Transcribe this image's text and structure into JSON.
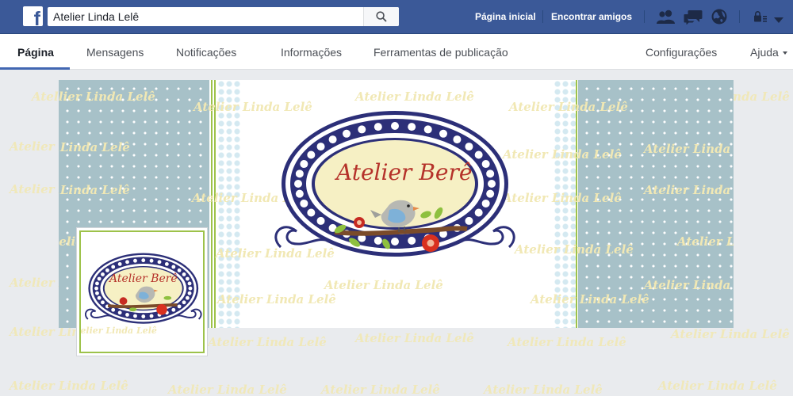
{
  "topbar": {
    "search": {
      "value": "Atelier Linda Lelê"
    },
    "nav": {
      "home": "Página inicial",
      "find_friends": "Encontrar amigos"
    },
    "colors": {
      "bar": "#3b5998",
      "accent": "#4267b2"
    },
    "icons": [
      "facebook-logo-icon",
      "search-icon",
      "friend-requests-icon",
      "messages-icon",
      "notifications-globe-icon",
      "privacy-lock-icon",
      "account-menu-icon"
    ]
  },
  "tabs": [
    {
      "label": "Página",
      "active": true
    },
    {
      "label": "Mensagens"
    },
    {
      "label": "Notificações"
    },
    {
      "label": "Informações"
    },
    {
      "label": "Ferramentas de publicação"
    },
    {
      "label": "Configurações"
    },
    {
      "label": "Ajuda"
    }
  ],
  "cover": {
    "logo_text": "Atelier Berê",
    "watermark_text": "Atelier Linda Lelê"
  },
  "profile": {
    "logo_text": "Atelier Berê"
  }
}
